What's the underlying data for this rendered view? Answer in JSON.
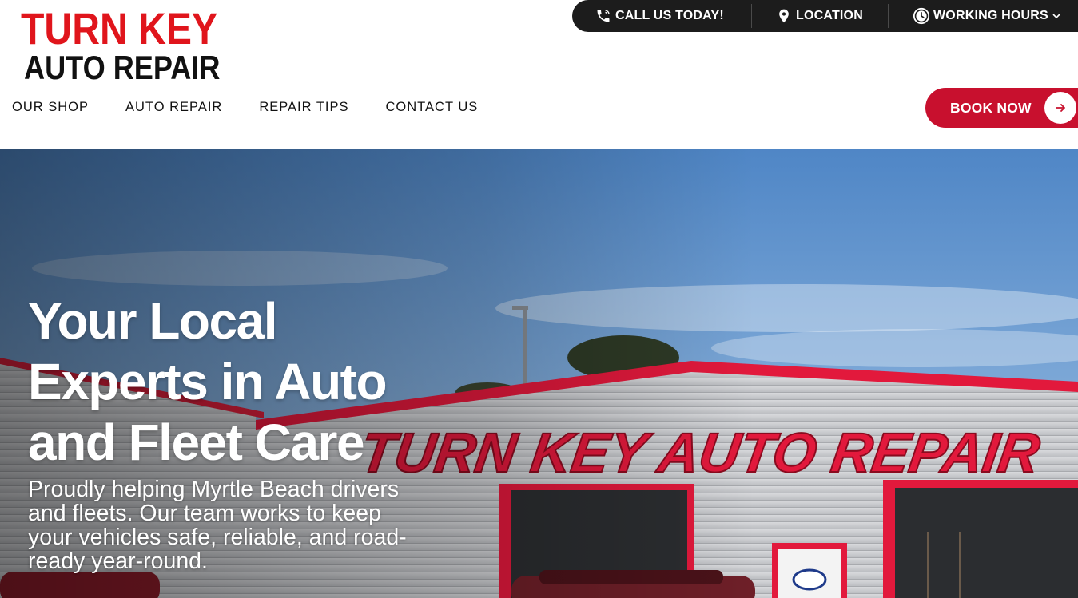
{
  "logo": {
    "line1": "TURN KEY",
    "line2": "AUTO REPAIR",
    "icon": "business-logo"
  },
  "topbar": {
    "call_label": "CALL US TODAY!",
    "call_icon": "phone-icon",
    "location_label": "LOCATION",
    "location_icon": "map-pin-icon",
    "hours_label": "WORKING HOURS",
    "hours_icon": "clock-icon",
    "hours_chevron": "chevron-down-icon"
  },
  "nav": {
    "items": [
      {
        "label": "OUR SHOP"
      },
      {
        "label": "AUTO REPAIR"
      },
      {
        "label": "REPAIR TIPS"
      },
      {
        "label": "CONTACT US"
      }
    ]
  },
  "book_button": {
    "label": "BOOK NOW",
    "icon": "arrow-right-icon"
  },
  "hero": {
    "title": "Your Local Experts in Auto and Fleet Care",
    "subtitle": "Proudly helping Myrtle Beach drivers and fleets. Our team works to keep your vehicles safe, reliable, and road-ready year-round.",
    "image_sign_text": "TURN KEY AUTO REPAIR"
  },
  "colors": {
    "brand_red": "#c8102e",
    "logo_red": "#e0151c",
    "topbar_bg": "#1c1c1c",
    "text_dark": "#111111"
  }
}
